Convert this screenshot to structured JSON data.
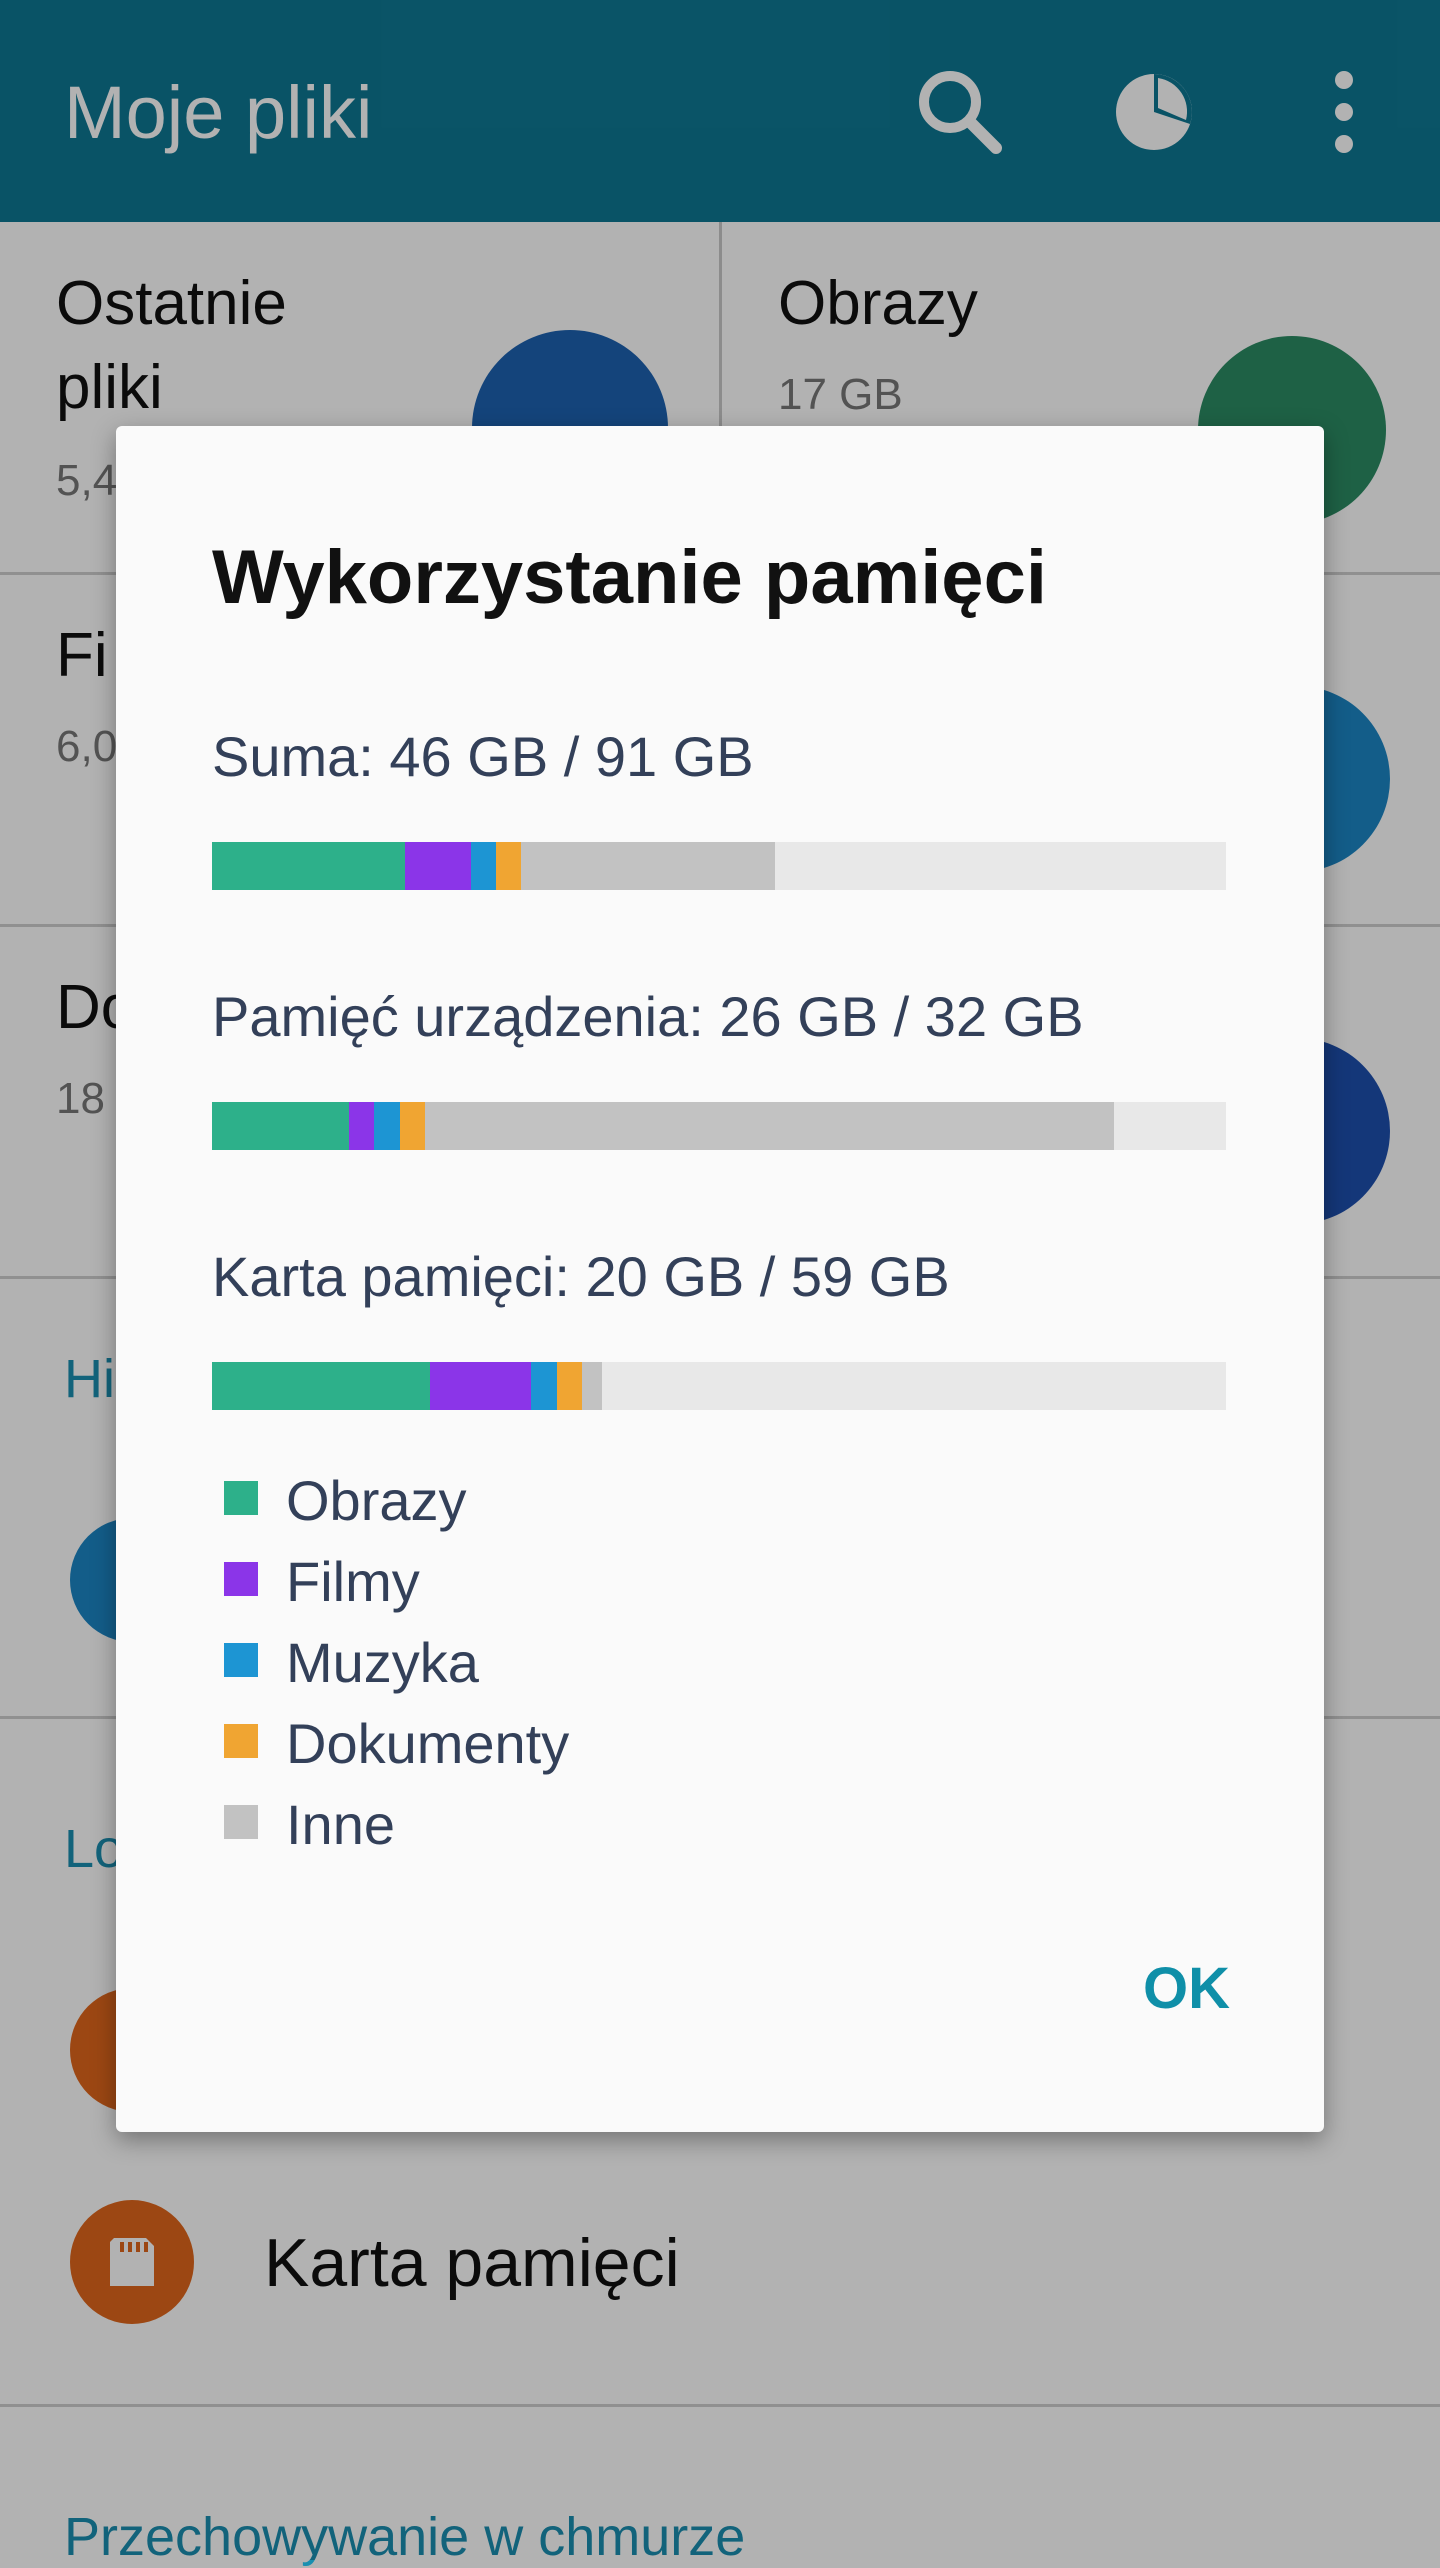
{
  "app_bar": {
    "title": "Moje pliki",
    "actions": [
      "search-icon",
      "storage-usage-icon",
      "more-options-icon"
    ]
  },
  "tiles": [
    {
      "title_line1": "Ostatnie",
      "title_line2": "pliki",
      "sub": "5,4"
    },
    {
      "title": "Obrazy",
      "sub": "17 GB"
    },
    {
      "title": "Fi",
      "sub": "6,0"
    },
    {
      "title": "Do",
      "sub": "18"
    }
  ],
  "sections": {
    "history_header": "Hi",
    "local_header": "Lo",
    "sd_card_label": "Karta pamięci",
    "cloud_header": "Przechowywanie w chmurze"
  },
  "dialog": {
    "title": "Wykorzystanie pamięci",
    "rows": [
      {
        "label": "Suma: 46 GB / 91 GB",
        "segments": {
          "Obrazy": 0.19,
          "Filmy": 0.065,
          "Muzyka": 0.025,
          "Dokumenty": 0.025,
          "Inne": 0.25
        }
      },
      {
        "label": "Pamięć urządzenia: 26 GB / 32 GB",
        "segments": {
          "Obrazy": 0.135,
          "Filmy": 0.025,
          "Muzyka": 0.025,
          "Dokumenty": 0.025,
          "Inne": 0.68
        }
      },
      {
        "label": "Karta pamięci: 20 GB / 59 GB",
        "segments": {
          "Obrazy": 0.215,
          "Filmy": 0.1,
          "Muzyka": 0.025,
          "Dokumenty": 0.025,
          "Inne": 0.02
        }
      }
    ],
    "legend": [
      {
        "label": "Obrazy",
        "color": "#2db08a"
      },
      {
        "label": "Filmy",
        "color": "#8b35e8"
      },
      {
        "label": "Muzyka",
        "color": "#1d95d3"
      },
      {
        "label": "Dokumenty",
        "color": "#f0a532"
      },
      {
        "label": "Inne",
        "color": "#c2c2c2"
      }
    ],
    "ok_label": "OK"
  }
}
